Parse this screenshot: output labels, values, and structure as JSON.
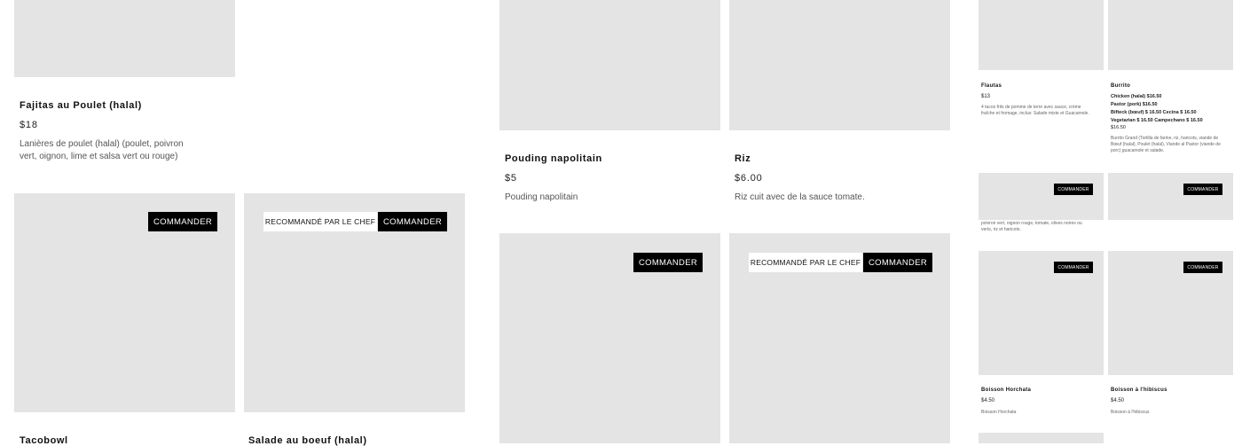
{
  "order_label": "COMMANDER",
  "chef_label": "RECOMMANDÉ PAR LE CHEF",
  "items": {
    "fajitas": {
      "title": "Fajitas au Poulet (halal)",
      "price": "$18",
      "desc": "Lanières de poulet (halal) (poulet, poivron vert, oignon, lime et salsa vert ou rouge)"
    },
    "tacobowl": {
      "title": "Tacobowl"
    },
    "salade": {
      "title": "Salade au boeuf (halal)"
    },
    "pouding": {
      "title": "Pouding napolitain",
      "price": "$5",
      "desc": "Pouding napolitain"
    },
    "riz": {
      "title": "Riz",
      "price": "$6.00",
      "desc": "Riz cuit avec de la sauce tomate."
    }
  },
  "right": {
    "flautas": {
      "title": "Flautas",
      "price": "$13",
      "desc": "4 tacos frits de pomme de terre avec sauce, crème fraîche et fromage, inclus: Salade mixte et Guacamole."
    },
    "burrito": {
      "title": "Burrito",
      "lines": [
        "Chicken (halal)  $16.50",
        "Pastor (pork)  $16.50",
        "Bifteck (bœuf)  $ 16.50      Cecina  $ 16.50",
        "Vegetarian  $ 16.50      Campechano  $ 16.50",
        "$16.50"
      ],
      "desc": "Burrito Grand (Tortilla de farine, riz, haricots, viande de Bœuf (halal), Poulet (halal), Viande al Pastor (viande de porc) guacamole et salade."
    },
    "partial_desc": "poivron vert, oignon rouge, tomate, olives noires ou verts, riz et haricots.",
    "horchata": {
      "title": "Boisson Horchata",
      "price": "$4.50",
      "desc": "Boisson Horchata"
    },
    "hibiscus": {
      "title": "Boisson à l'hibiscus",
      "price": "$4.50",
      "desc": "Boisson à l'hibiscus"
    }
  }
}
